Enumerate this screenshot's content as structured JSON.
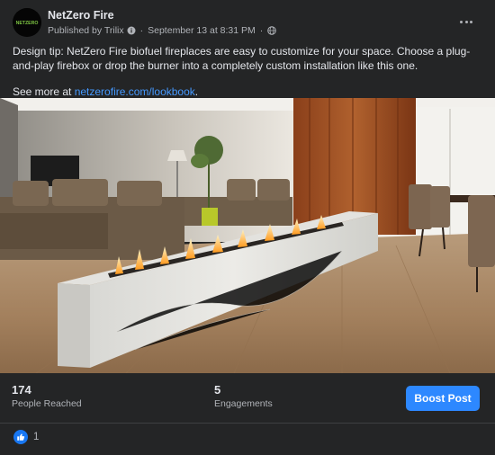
{
  "post": {
    "page_name": "NetZero Fire",
    "avatar_text": "NETZERO",
    "published_by": "Published by Trilix",
    "separator": "·",
    "timestamp": "September 13 at 8:31 PM",
    "audience_icon": "globe-icon",
    "more_icon": "ellipsis-icon",
    "text_line": "Design tip: NetZero Fire biofuel fireplaces are easy to customize for your space. Choose a plug-and-play firebox or drop the burner into a completely custom installation like this one.",
    "see_more_prefix": "See more at ",
    "see_more_link": "netzerofire.com/lookbook",
    "see_more_suffix": ".",
    "image_alt": "Living room with a custom biofuel fireplace built into a white marble ledge"
  },
  "insights": {
    "reached_value": "174",
    "reached_label": "People Reached",
    "engagements_value": "5",
    "engagements_label": "Engagements",
    "boost_label": "Boost Post"
  },
  "reactions": {
    "icon": "thumbs-up-icon",
    "count": "1"
  },
  "colors": {
    "background": "#242526",
    "accent": "#2d88ff",
    "link": "#4599ff",
    "text_secondary": "#b0b3b8"
  }
}
